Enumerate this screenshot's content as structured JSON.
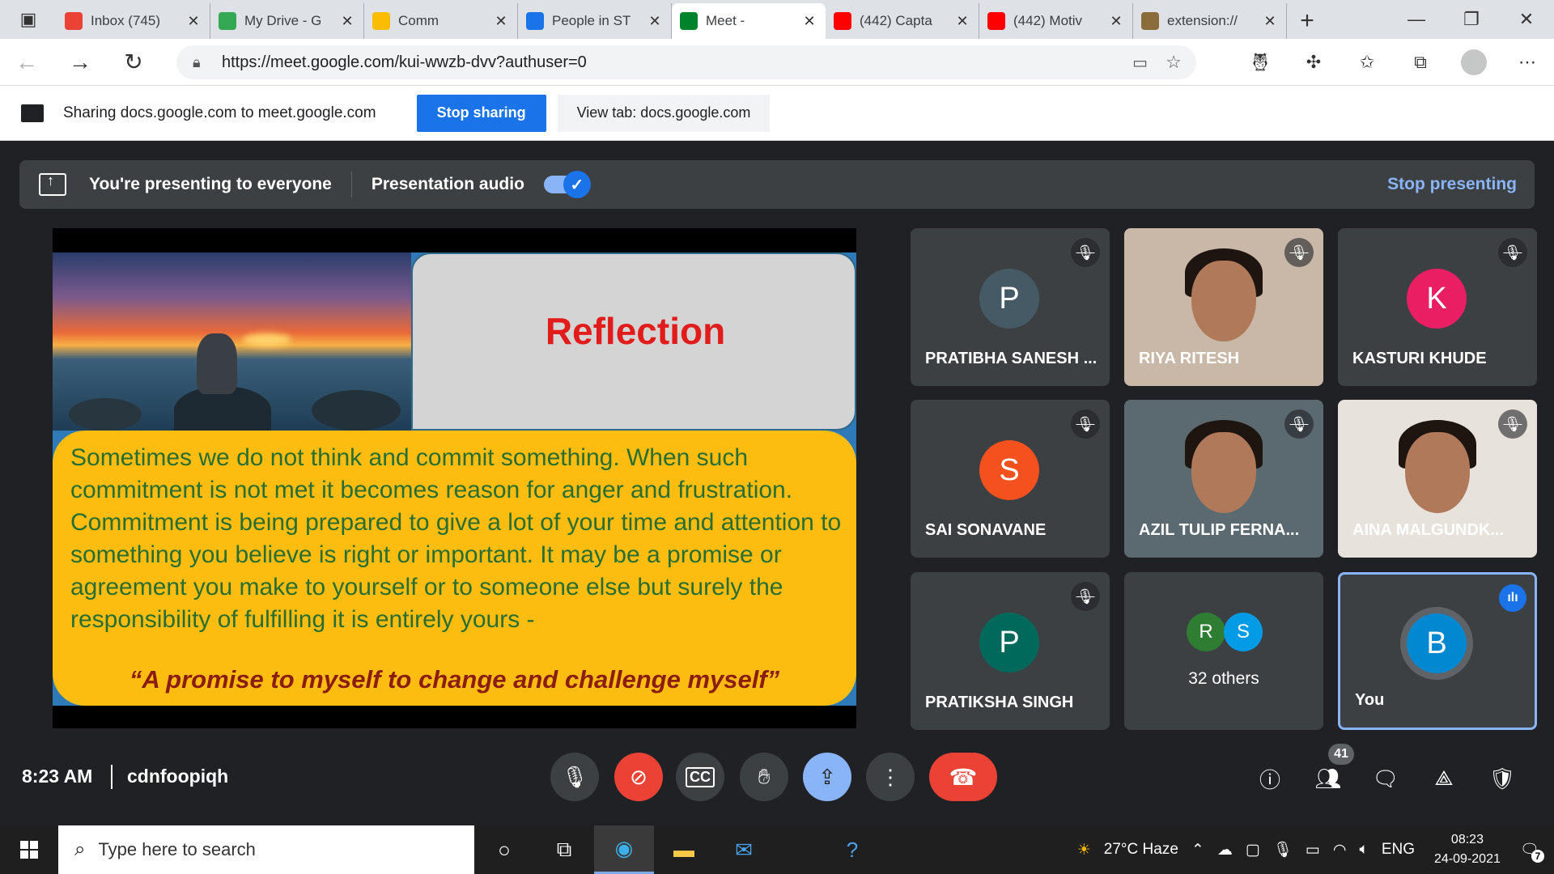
{
  "browser": {
    "tabs": [
      {
        "title": "Inbox (745)",
        "icon": "gmail-icon",
        "color": "#ea4335"
      },
      {
        "title": "My Drive - G",
        "icon": "drive-icon",
        "color": "#34a853"
      },
      {
        "title": "Comm",
        "icon": "slides-icon",
        "color": "#fbbc04"
      },
      {
        "title": "People in ST",
        "icon": "people-icon",
        "color": "#1a73e8"
      },
      {
        "title": "Meet -",
        "icon": "meet-icon",
        "color": "#00832d"
      },
      {
        "title": "(442) Capta",
        "icon": "youtube-icon",
        "color": "#ff0000"
      },
      {
        "title": "(442) Motiv",
        "icon": "youtube-icon",
        "color": "#ff0000"
      },
      {
        "title": "extension://",
        "icon": "extension-icon",
        "color": "#8a6d3b"
      }
    ],
    "url": "https://meet.google.com/kui-wwzb-dvv?authuser=0"
  },
  "sharebar": {
    "text": "Sharing docs.google.com to meet.google.com",
    "stop_label": "Stop sharing",
    "view_label": "View tab: docs.google.com"
  },
  "presentation": {
    "status": "You're presenting to everyone",
    "audio_label": "Presentation audio",
    "audio_on": true,
    "stop_label": "Stop presenting"
  },
  "slide": {
    "heading": "Reflection",
    "body": "Sometimes we do not think and commit something. When such commitment is not met it becomes reason for anger and frustration. Commitment is being prepared to give a lot of your time and attention to something you believe is right or important. It may be a promise or agreement you make to yourself or to someone else but surely the responsibility of fulfilling it is entirely yours -",
    "quote": "“A promise to myself to change and challenge myself”"
  },
  "participants": [
    {
      "name": "PRATIBHA SANESH ...",
      "initial": "P",
      "color": "#455a64",
      "video": false,
      "muted": true
    },
    {
      "name": "RIYA RITESH",
      "initial": "",
      "color": "",
      "video": true,
      "muted": true
    },
    {
      "name": "KASTURI KHUDE",
      "initial": "K",
      "color": "#e91e63",
      "video": false,
      "muted": true
    },
    {
      "name": "SAI SONAVANE",
      "initial": "S",
      "color": "#f4511e",
      "video": false,
      "muted": true
    },
    {
      "name": "AZIL TULIP FERNA...",
      "initial": "",
      "color": "",
      "video": true,
      "muted": true
    },
    {
      "name": "AINA MALGUNDK...",
      "initial": "",
      "color": "",
      "video": true,
      "muted": true
    },
    {
      "name": "PRATIKSHA SINGH",
      "initial": "P",
      "color": "#00695c",
      "video": false,
      "muted": true
    }
  ],
  "others": {
    "label": "32 others",
    "initials": [
      "R",
      "S"
    ],
    "colors": [
      "#2e7d32",
      "#039be5"
    ]
  },
  "self": {
    "name": "You",
    "initial": "B",
    "color": "#0288d1"
  },
  "meeting": {
    "time": "8:23 AM",
    "code": "cdnfoopiqh",
    "participant_count": "41"
  },
  "taskbar": {
    "search_placeholder": "Type here to search",
    "weather": "27°C  Haze",
    "language": "ENG",
    "time": "08:23",
    "date": "24-09-2021",
    "notifications": "7"
  }
}
